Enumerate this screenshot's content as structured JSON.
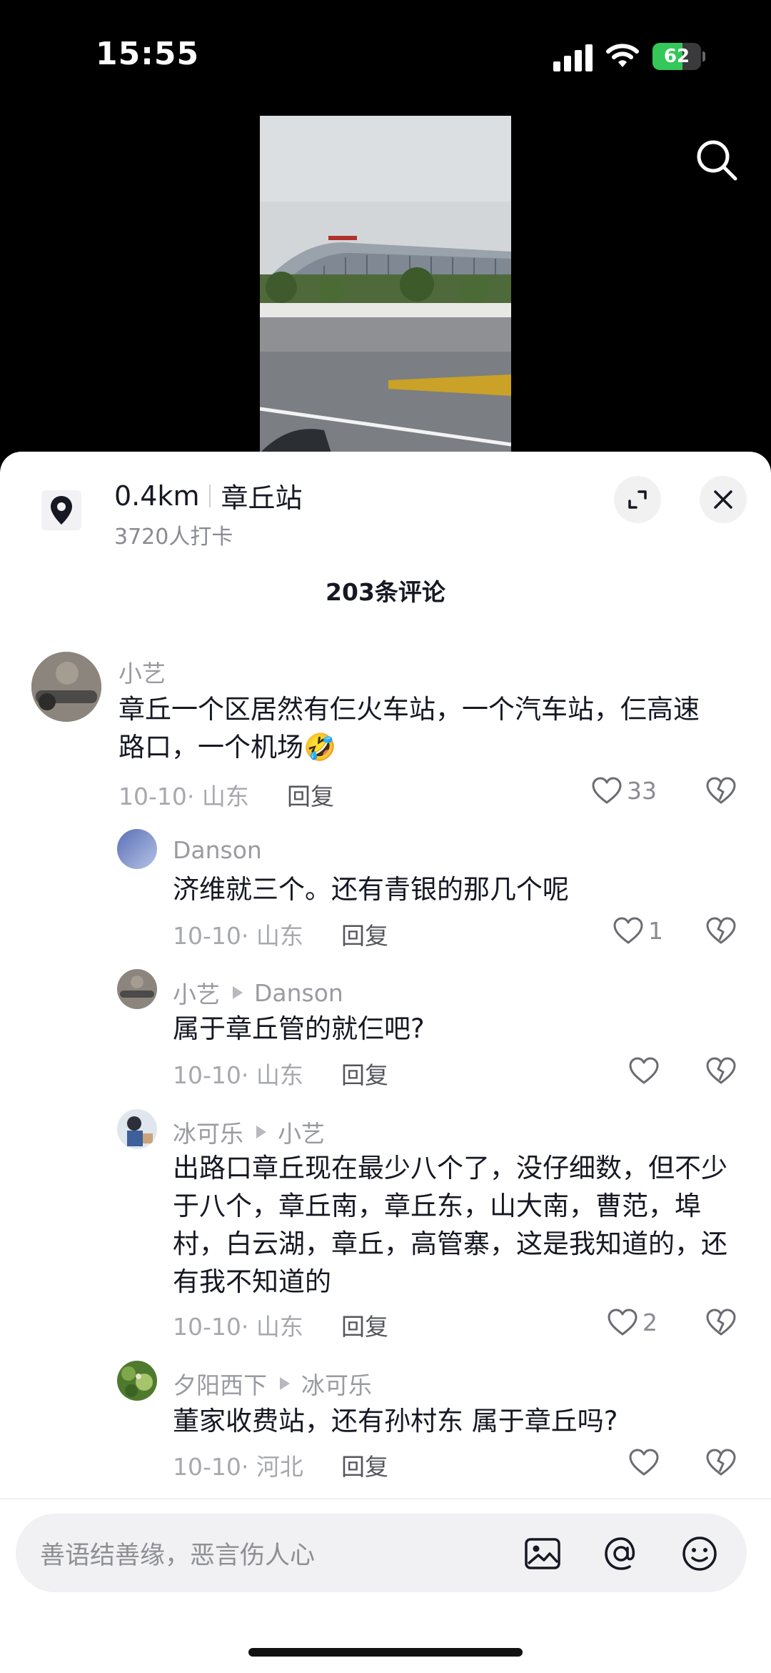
{
  "status_bar": {
    "time": "15:55",
    "battery_level": "62"
  },
  "location": {
    "distance": "0.4km",
    "name": "章丘站",
    "checkins": "3720人打卡",
    "icon": "location-pin-icon"
  },
  "comments_header": {
    "count_label": "203条评论"
  },
  "comments": [
    {
      "user": "小艺",
      "text": "章丘一个区居然有仨火车站，一个汽车站，仨高速路口，一个机场🤣",
      "date": "10-10",
      "region": "山东",
      "reply_label": "回复",
      "likes": "33"
    },
    {
      "user": "Danson",
      "text": "济维就三个。还有青银的那几个呢",
      "date": "10-10",
      "region": "山东",
      "reply_label": "回复",
      "likes": "1"
    },
    {
      "user": "小艺",
      "reply_to": "Danson",
      "text": "属于章丘管的就仨吧?",
      "date": "10-10",
      "region": "山东",
      "reply_label": "回复",
      "likes": ""
    },
    {
      "user": "冰可乐",
      "reply_to": "小艺",
      "text": "出路口章丘现在最少八个了，没仔细数，但不少于八个，章丘南，章丘东，山大南，曹范，埠村，白云湖，章丘，高管寨，这是我知道的，还有我不知道的",
      "date": "10-10",
      "region": "山东",
      "reply_label": "回复",
      "likes": "2"
    },
    {
      "user": "夕阳西下",
      "reply_to": "冰可乐",
      "text": "董家收费站，还有孙村东 属于章丘吗?",
      "date": "10-10",
      "region": "河北",
      "reply_label": "回复",
      "likes": ""
    }
  ],
  "input": {
    "placeholder": "善语结善缘，恶言伤人心"
  },
  "colors": {
    "battery_green": "#34c759",
    "text_primary": "#161823",
    "text_secondary": "#8a8b91"
  }
}
